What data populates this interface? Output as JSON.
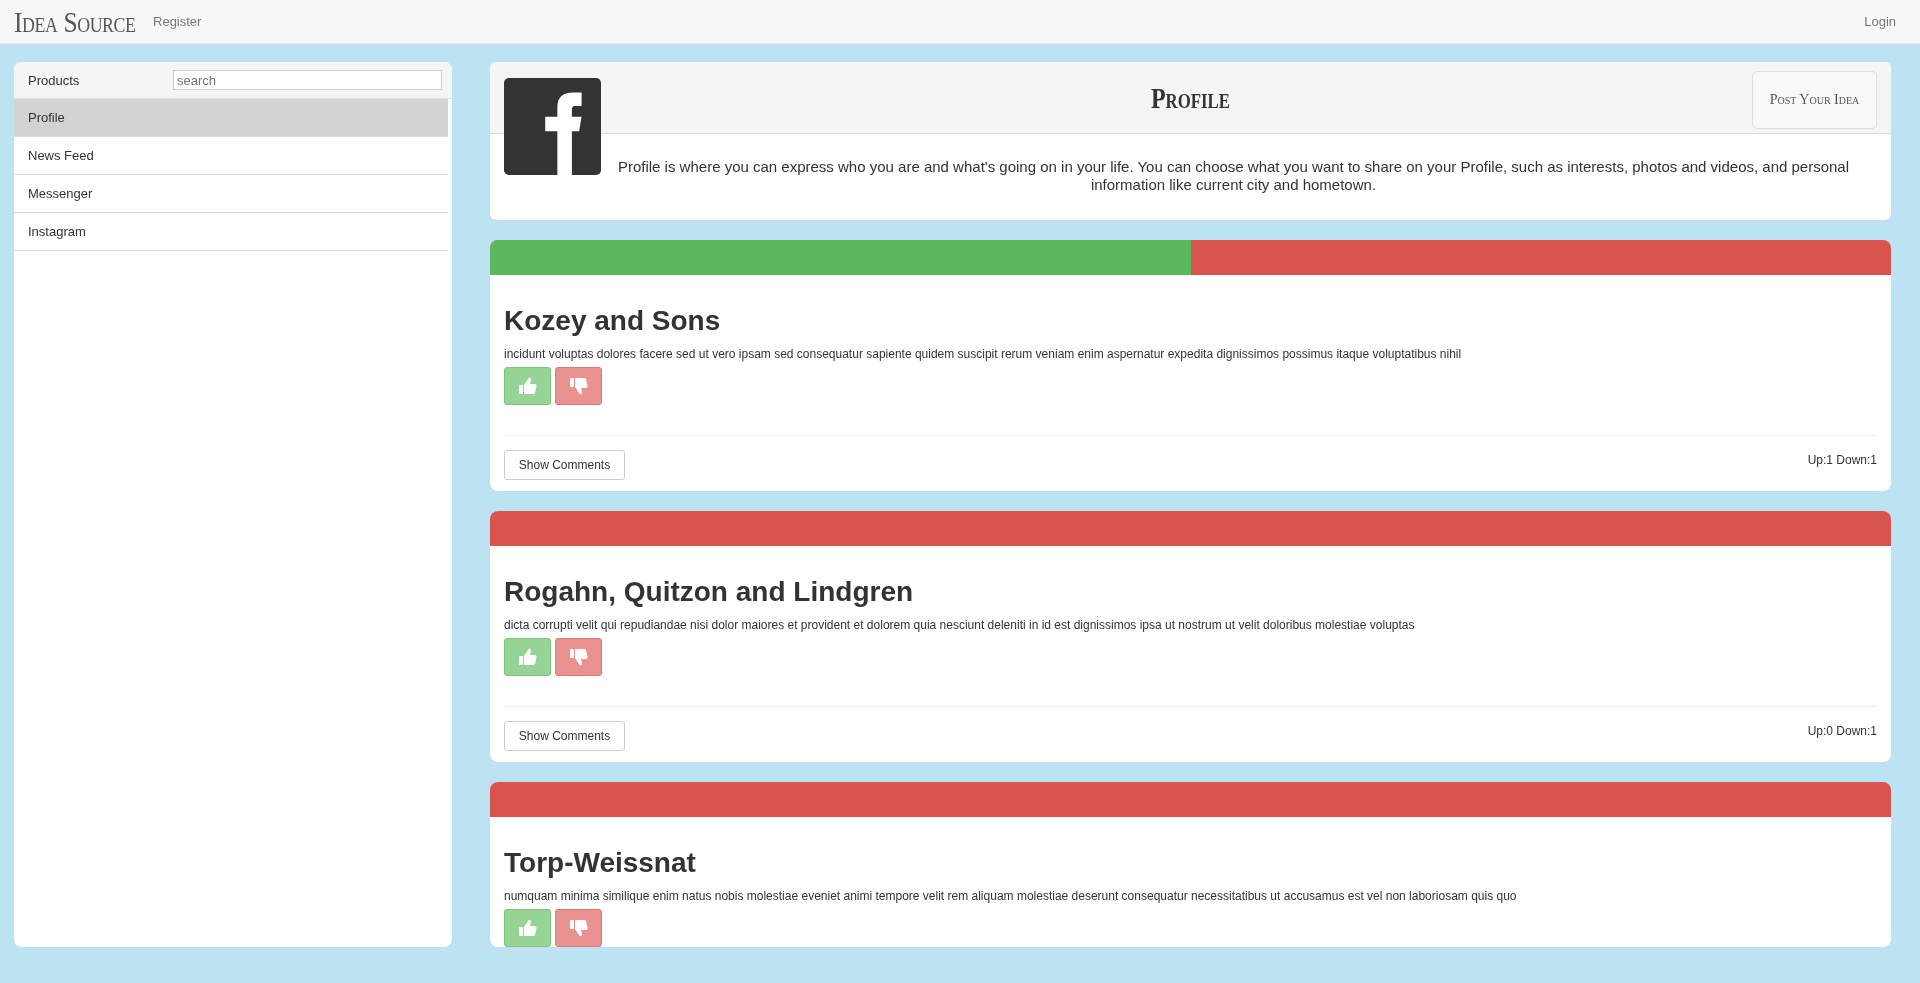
{
  "navbar": {
    "brand": "Idea Source",
    "links": [
      {
        "label": "Register"
      }
    ],
    "login": "Login"
  },
  "sidebar": {
    "heading": "Products",
    "search": {
      "placeholder": "search"
    },
    "items": [
      {
        "label": "Profile",
        "selected": true
      },
      {
        "label": "News Feed",
        "selected": false
      },
      {
        "label": "Messenger",
        "selected": false
      },
      {
        "label": "Instagram",
        "selected": false
      }
    ]
  },
  "product": {
    "title": "Profile",
    "post_button": "Post Your Idea",
    "description": "Profile is where you can express who you are and what's going on in your life. You can choose what you want to share on your Profile, such as interests, photos and videos, and personal information like current city and hometown."
  },
  "ideas": [
    {
      "title": "Kozey and Sons",
      "description": "incidunt voluptas dolores facere sed ut vero ipsam sed consequatur sapiente quidem suscipit rerum veniam enim aspernatur expedita dignissimos possimus itaque voluptatibus nihil",
      "level": 0.5,
      "comments_button": "Show Comments",
      "votes": "Up:1 Down:1"
    },
    {
      "title": "Rogahn, Quitzon and Lindgren",
      "description": "dicta corrupti velit qui repudiandae nisi dolor maiores et provident et dolorem quia nesciunt deleniti in id est dignissimos ipsa ut nostrum ut velit doloribus molestiae voluptas",
      "level": 0,
      "comments_button": "Show Comments",
      "votes": "Up:0 Down:1"
    },
    {
      "title": "Torp-Weissnat",
      "description": "numquam minima similique enim natus nobis molestiae eveniet animi tempore velit rem aliquam molestiae deserunt consequatur necessitatibus ut accusamus est vel non laboriosam quis quo",
      "level": 0
    }
  ]
}
